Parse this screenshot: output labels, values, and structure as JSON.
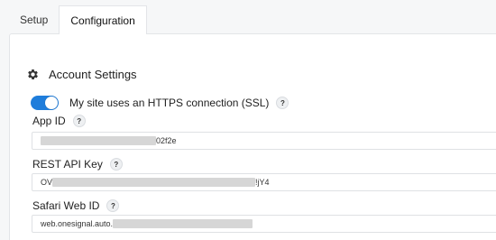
{
  "tabs": [
    {
      "label": "Setup"
    },
    {
      "label": "Configuration",
      "active": true
    }
  ],
  "section": {
    "title": "Account Settings",
    "icon": "gear-icon"
  },
  "ssl": {
    "label": "My site uses an HTTPS connection (SSL)",
    "enabled": true,
    "help": "?"
  },
  "fields": {
    "app_id": {
      "label": "App ID",
      "help": "?",
      "value_prefix": "",
      "value_suffix": "02f2e"
    },
    "rest_api_key": {
      "label": "REST API Key",
      "help": "?",
      "value_prefix": "OV",
      "value_suffix": "!jY4"
    },
    "safari_web_id": {
      "label": "Safari Web ID",
      "help": "?",
      "value_prefix": "web.onesignal.auto.",
      "value_suffix": ""
    }
  },
  "colors": {
    "toggle_on": "#1f7ddb"
  }
}
